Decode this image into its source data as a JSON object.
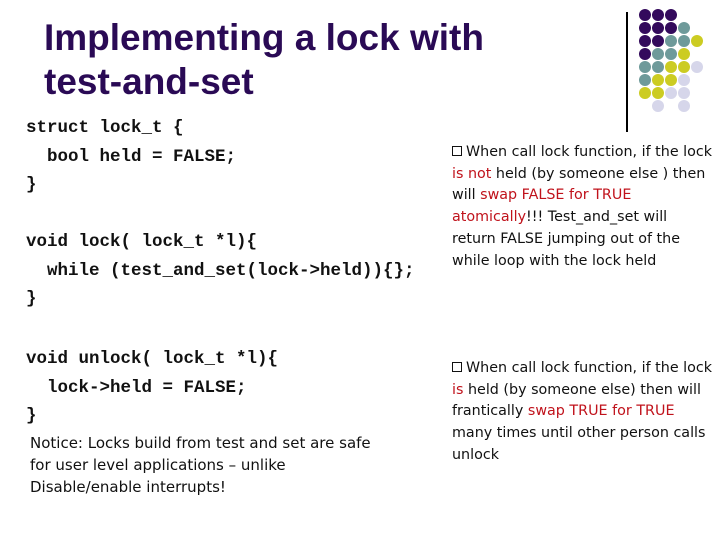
{
  "title": {
    "line1": "Implementing a lock with",
    "line2": "test-and-set"
  },
  "colors": {
    "title": "#2a0a55",
    "highlight": "#c0121b",
    "dot_purple": "#330a5c",
    "dot_teal": "#6e9a9a",
    "dot_yellow": "#cccc22",
    "dot_lavender": "#d6d6ea"
  },
  "decoration": {
    "dot_grid": [
      [
        "P",
        "P",
        "P",
        "",
        ""
      ],
      [
        "P",
        "P",
        "P",
        "T",
        ""
      ],
      [
        "P",
        "P",
        "T",
        "T",
        "Y"
      ],
      [
        "P",
        "T",
        "T",
        "Y",
        ""
      ],
      [
        "T",
        "T",
        "Y",
        "Y",
        "L"
      ],
      [
        "T",
        "Y",
        "Y",
        "L",
        ""
      ],
      [
        "Y",
        "Y",
        "L",
        "L",
        ""
      ],
      [
        "",
        "L",
        "",
        "L",
        ""
      ]
    ]
  },
  "code": {
    "struct_block": [
      "struct lock_t {",
      "  bool held = FALSE;",
      "}"
    ],
    "lock_block": [
      "void lock( lock_t *l){",
      "  while (test_and_set(lock->held)){};",
      "}"
    ],
    "unlock_block": [
      "void unlock( lock_t *l){",
      "  lock->held = FALSE;",
      "}"
    ]
  },
  "notice": "Notice: Locks build from test and set are safe for user level applications – unlike Disable/enable interrupts!",
  "notes": [
    {
      "parts": [
        {
          "text": "When call lock function, if the lock ",
          "red": false
        },
        {
          "text": "is not",
          "red": true
        },
        {
          "text": " held (by someone else ) then will ",
          "red": false
        },
        {
          "text": "swap FALSE for TRUE atomically",
          "red": true
        },
        {
          "text": "!!!  Test_and_set will return FALSE jumping out of the while loop with the lock held",
          "red": false
        }
      ]
    },
    {
      "parts": [
        {
          "text": "When call lock function, if the lock ",
          "red": false
        },
        {
          "text": "is",
          "red": true
        },
        {
          "text": " held (by someone else) then will frantically ",
          "red": false
        },
        {
          "text": "swap TRUE for TRUE",
          "red": true
        },
        {
          "text": " many times until other person calls unlock",
          "red": false
        }
      ]
    }
  ]
}
